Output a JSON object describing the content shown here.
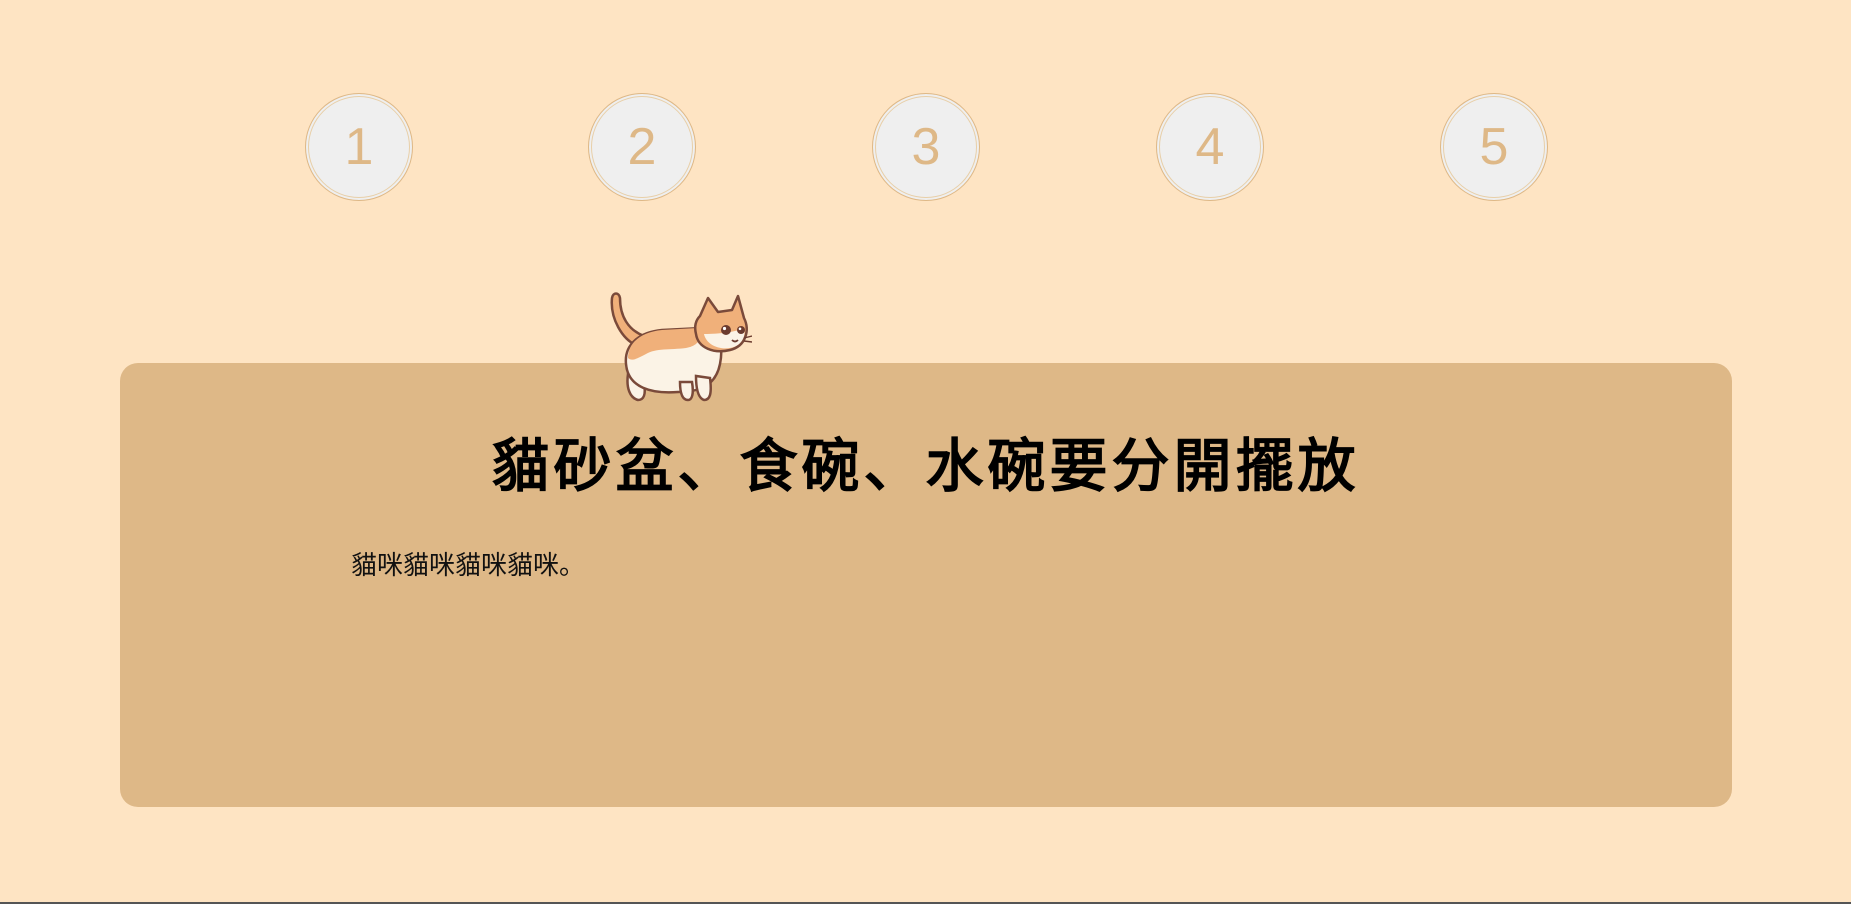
{
  "steps": [
    {
      "label": "1"
    },
    {
      "label": "2"
    },
    {
      "label": "3"
    },
    {
      "label": "4"
    },
    {
      "label": "5"
    }
  ],
  "card": {
    "title": "貓砂盆、食碗、水碗要分開擺放",
    "text": "貓咪貓咪貓咪貓咪。"
  },
  "mascot": {
    "icon": "cat-icon"
  },
  "colors": {
    "background": "#FEE4C3",
    "card": "#DEB887",
    "step_fill": "#EFEFEF",
    "step_text": "#DEB887",
    "cat_orange": "#F0B07A",
    "cat_cream": "#FBF3E6",
    "cat_outline": "#7A4A3A"
  }
}
